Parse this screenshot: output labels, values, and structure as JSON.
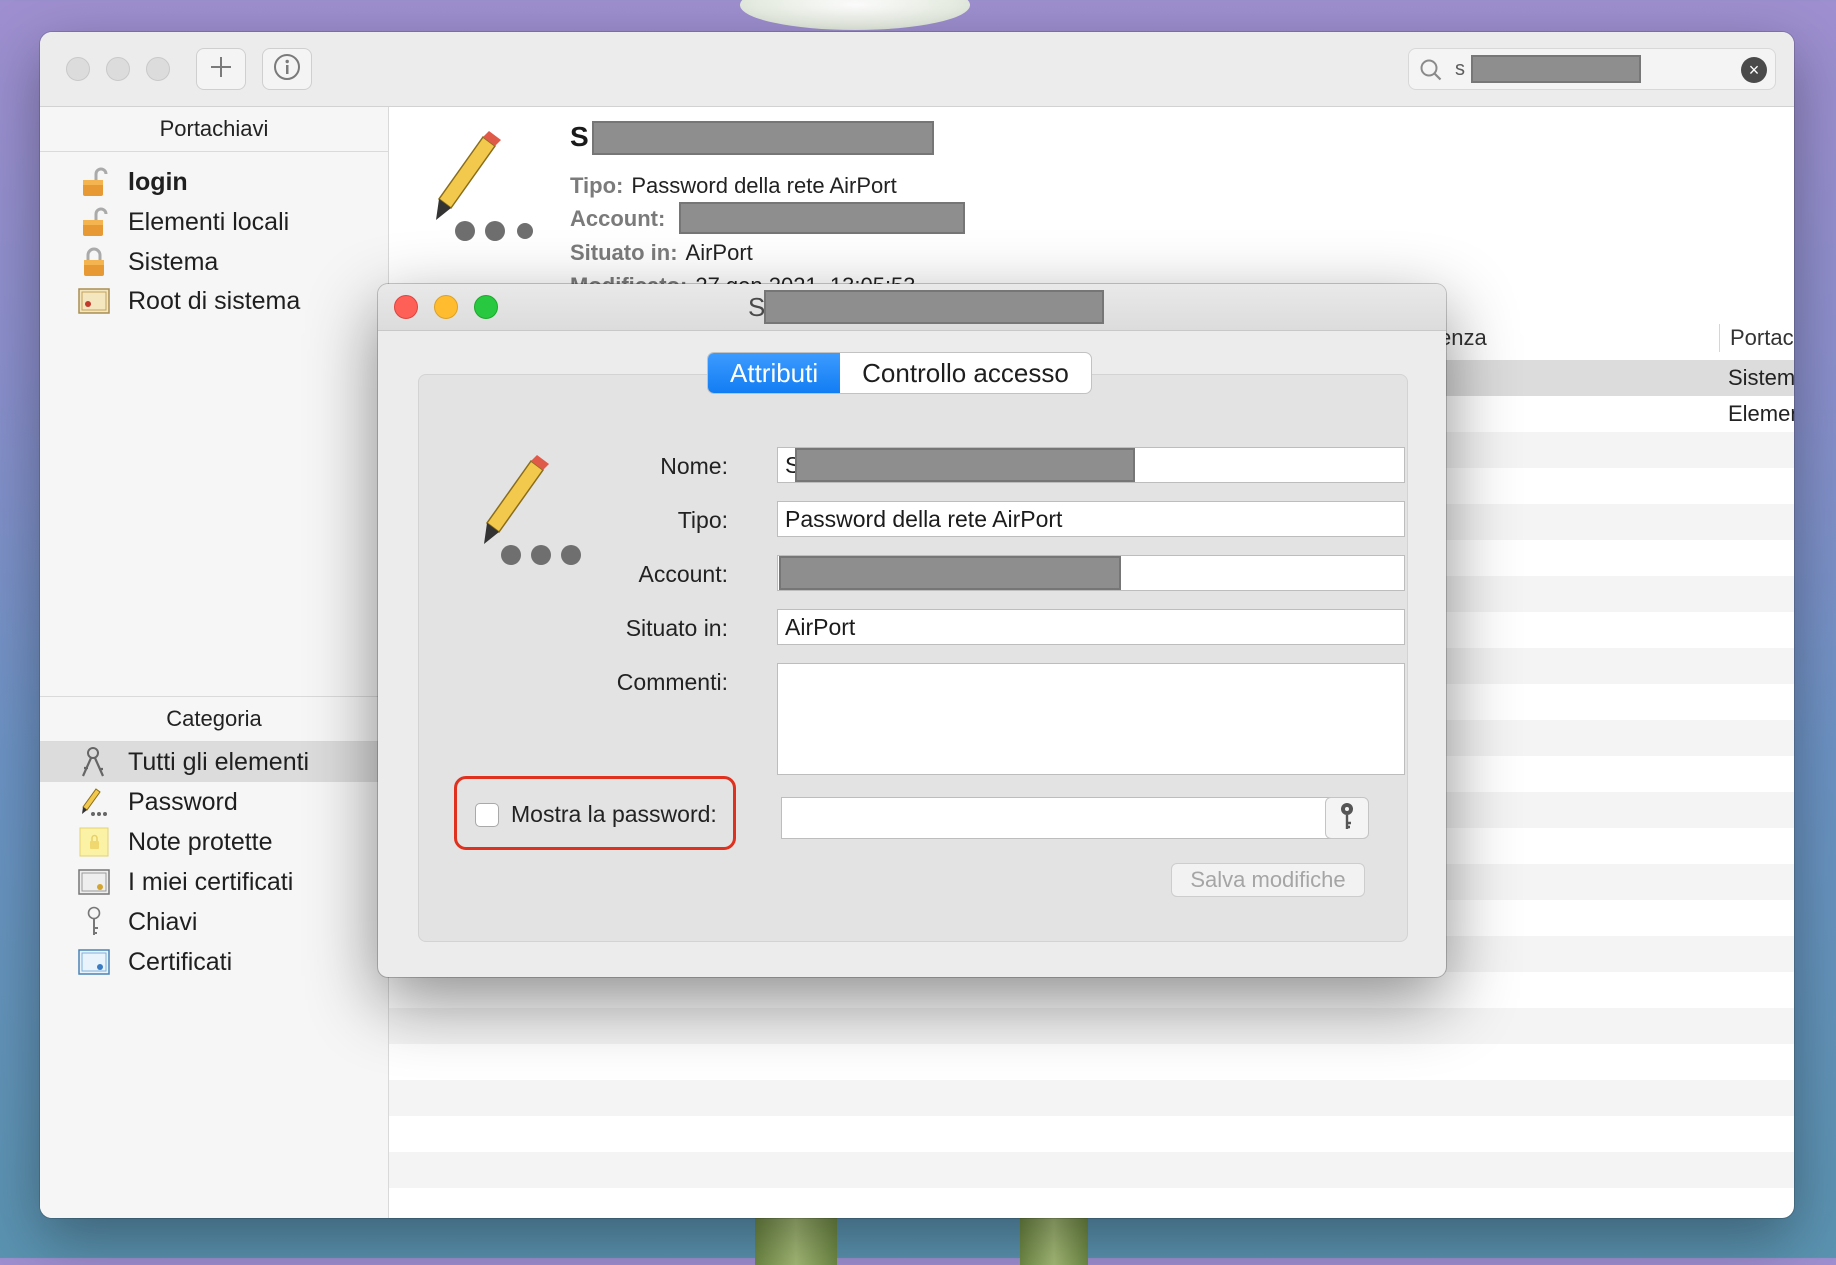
{
  "search": {
    "query": "s"
  },
  "sidebar": {
    "keychains_header": "Portachiavi",
    "keychains": [
      {
        "label": "login",
        "icon": "unlocked-padlock-icon"
      },
      {
        "label": "Elementi locali",
        "icon": "unlocked-padlock-icon"
      },
      {
        "label": "Sistema",
        "icon": "locked-padlock-icon"
      },
      {
        "label": "Root di sistema",
        "icon": "certificate-icon"
      }
    ],
    "category_header": "Categoria",
    "categories": [
      {
        "label": "Tutti gli elementi",
        "icon": "keys-icon"
      },
      {
        "label": "Password",
        "icon": "pencil-password-icon"
      },
      {
        "label": "Note protette",
        "icon": "secure-note-icon"
      },
      {
        "label": "I miei certificati",
        "icon": "my-certificate-icon"
      },
      {
        "label": "Chiavi",
        "icon": "key-icon"
      },
      {
        "label": "Certificati",
        "icon": "certificate-icon"
      }
    ]
  },
  "detail": {
    "title": "S",
    "tipo_label": "Tipo:",
    "tipo_value": "Password della rete AirPort",
    "account_label": "Account:",
    "situato_label": "Situato in:",
    "situato_value": "AirPort",
    "modificato_label": "Modificato:",
    "modificato_value": "27 gen 2021, 13:05:53"
  },
  "list": {
    "col_scadenza": "enza",
    "col_portachiavi": "Portachiav",
    "rows": [
      "Sistema",
      "Elementi lo"
    ]
  },
  "dialog": {
    "title": "S",
    "tabs": [
      "Attributi",
      "Controllo accesso"
    ],
    "nome_label": "Nome:",
    "nome_value": "S",
    "tipo_label": "Tipo:",
    "tipo_value": "Password della rete AirPort",
    "account_label": "Account:",
    "situato_label": "Situato in:",
    "situato_value": "AirPort",
    "commenti_label": "Commenti:",
    "show_password_label": "Mostra la password:",
    "save_label": "Salva modifiche"
  },
  "colors": {
    "accent": "#127df3",
    "highlight": "#e0301e",
    "close": "#fe5f57",
    "minimize": "#febc2e",
    "zoom": "#28c840"
  }
}
